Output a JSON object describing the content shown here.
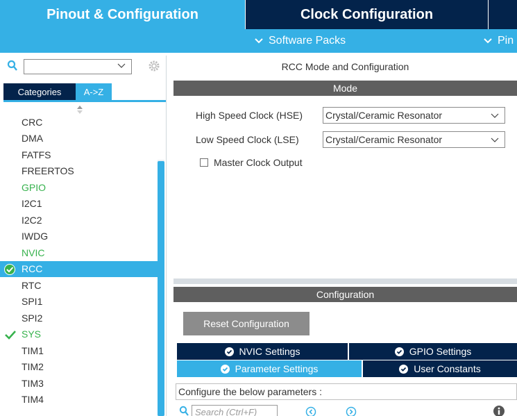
{
  "top_tabs": {
    "pinout": "Pinout & Configuration",
    "clock": "Clock Configuration"
  },
  "subbar": {
    "software_packs": "Software Packs",
    "pinout_partial": "Pin"
  },
  "left_panel": {
    "search_value": "",
    "categories_tab": "Categories",
    "az_tab": "A->Z",
    "peripherals": [
      {
        "label": "CRC",
        "state": "normal"
      },
      {
        "label": "DMA",
        "state": "normal"
      },
      {
        "label": "FATFS",
        "state": "normal"
      },
      {
        "label": "FREERTOS",
        "state": "normal"
      },
      {
        "label": "GPIO",
        "state": "green"
      },
      {
        "label": "I2C1",
        "state": "normal"
      },
      {
        "label": "I2C2",
        "state": "normal"
      },
      {
        "label": "IWDG",
        "state": "normal"
      },
      {
        "label": "NVIC",
        "state": "green"
      },
      {
        "label": "RCC",
        "state": "selected"
      },
      {
        "label": "RTC",
        "state": "normal"
      },
      {
        "label": "SPI1",
        "state": "normal"
      },
      {
        "label": "SPI2",
        "state": "normal"
      },
      {
        "label": "SYS",
        "state": "green-checked"
      },
      {
        "label": "TIM1",
        "state": "normal"
      },
      {
        "label": "TIM2",
        "state": "normal"
      },
      {
        "label": "TIM3",
        "state": "normal"
      },
      {
        "label": "TIM4",
        "state": "normal"
      }
    ]
  },
  "right_panel": {
    "title": "RCC Mode and Configuration",
    "mode_header": "Mode",
    "hse_label": "High Speed Clock (HSE)",
    "hse_value": "Crystal/Ceramic Resonator",
    "lse_label": "Low Speed Clock (LSE)",
    "lse_value": "Crystal/Ceramic Resonator",
    "master_clock_output": "Master Clock Output",
    "master_clock_output_checked": false,
    "configuration_header": "Configuration",
    "reset_button": "Reset Configuration",
    "tabs": {
      "nvic": "NVIC Settings",
      "gpio": "GPIO Settings",
      "parameter": "Parameter Settings",
      "user_constants": "User Constants"
    },
    "param_hint": "Configure the below parameters :",
    "search_placeholder": "Search (Ctrl+F)"
  },
  "colors": {
    "accent_blue": "#35b0e5",
    "dark_navy": "#03234b",
    "header_gray": "#5f5f5f",
    "status_green": "#37b24d",
    "button_gray": "#8c8c8c"
  }
}
